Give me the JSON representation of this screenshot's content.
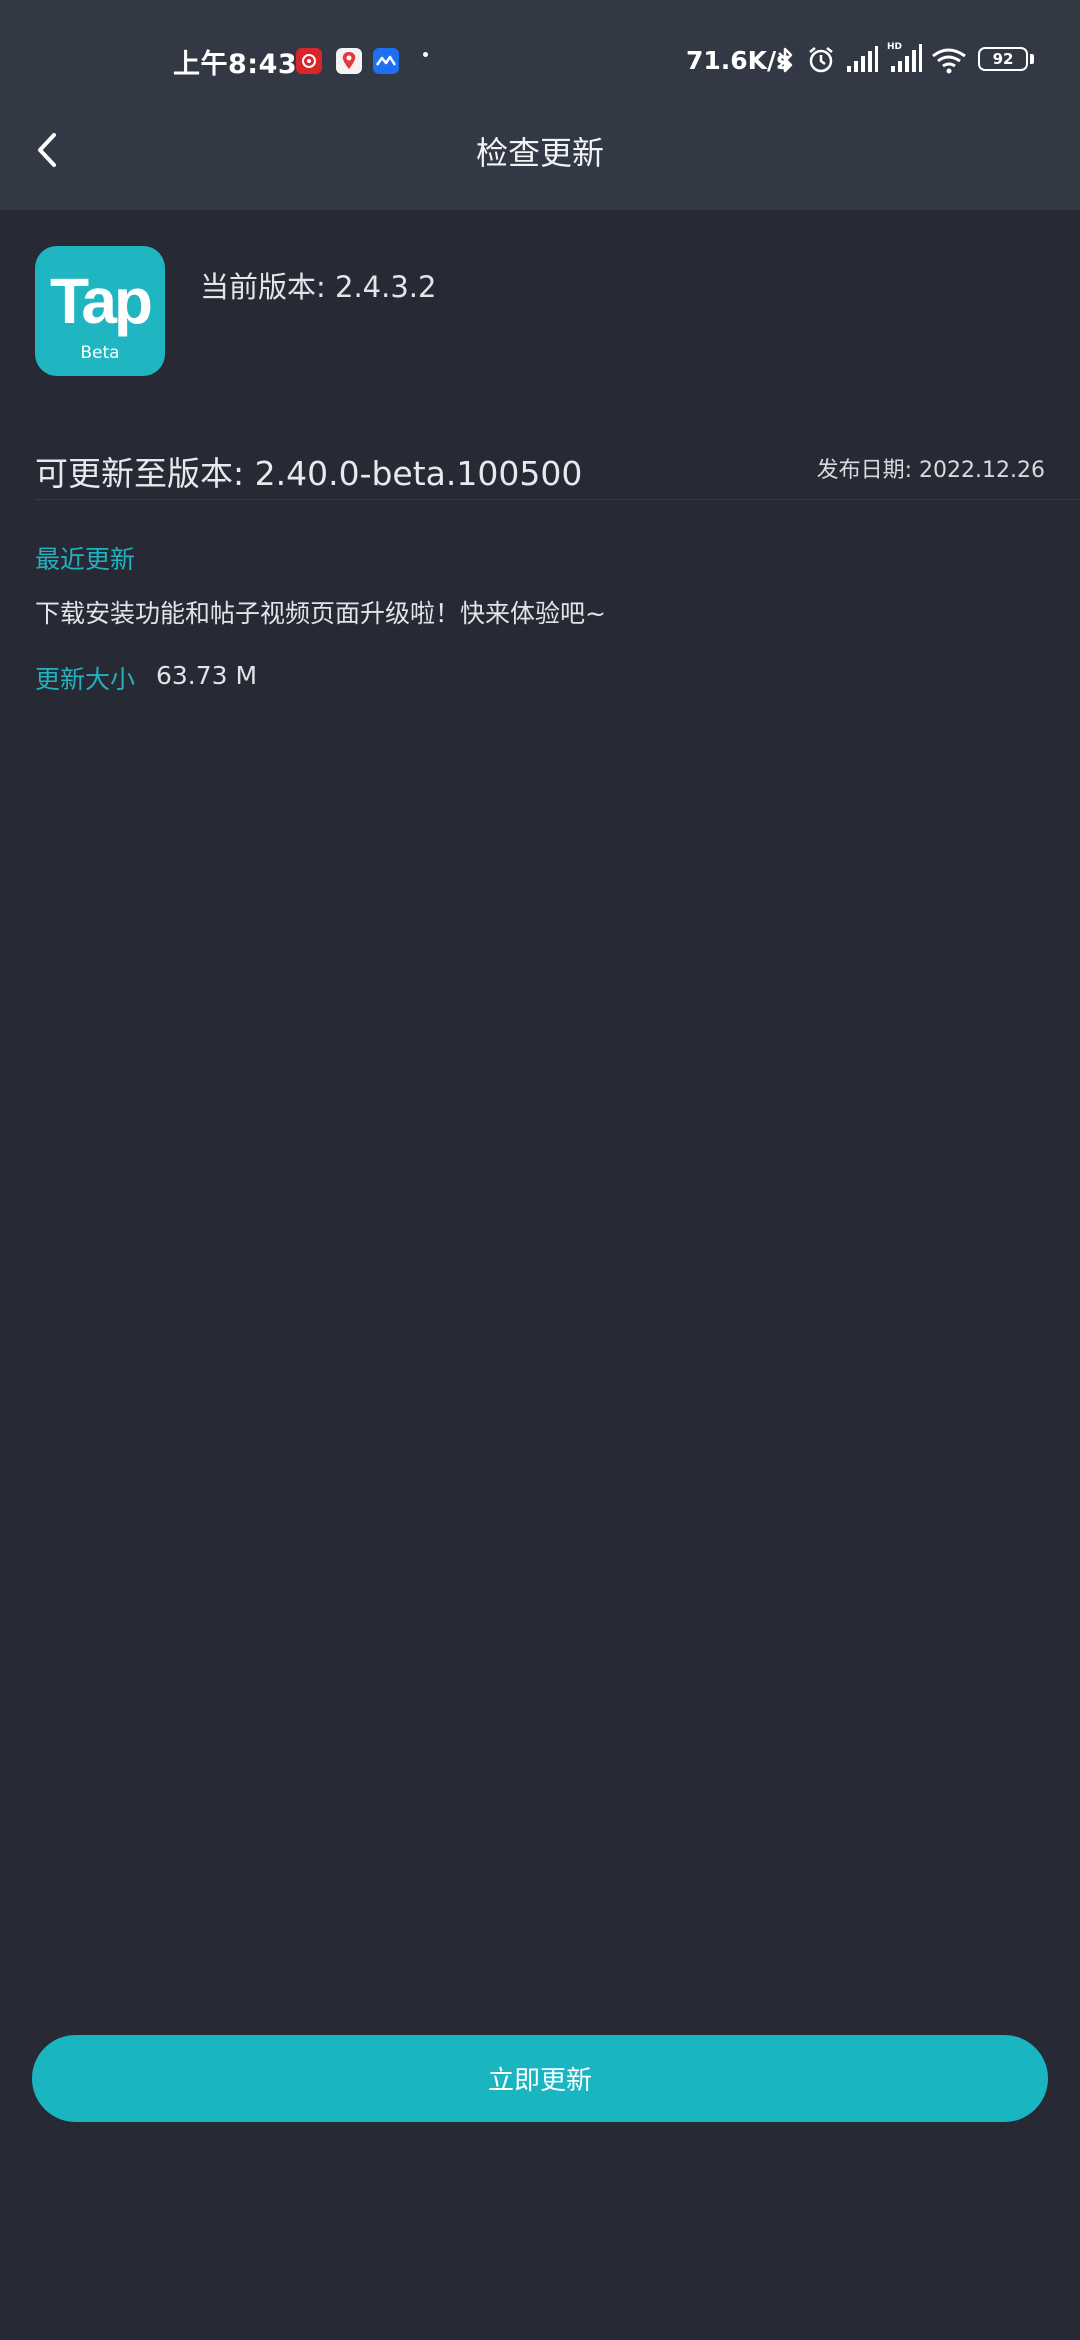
{
  "status_bar": {
    "time": "上午8:43",
    "net_speed": "71.6K/s",
    "battery": "92",
    "notification_icons": [
      "netease-music-icon",
      "maps-icon",
      "feishu-icon"
    ],
    "system_icons": [
      "bluetooth-icon",
      "alarm-icon",
      "signal-icon",
      "signal-hd-icon",
      "wifi-icon"
    ]
  },
  "header": {
    "title": "检查更新",
    "back_icon": "chevron-left-icon"
  },
  "app": {
    "icon_text": "Tap",
    "icon_sub": "Beta",
    "current_version": "当前版本: 2.4.3.2"
  },
  "update": {
    "target_version": "可更新至版本: 2.40.0-beta.100500",
    "release_date": "发布日期: 2022.12.26",
    "recent_label": "最近更新",
    "recent_text": "下载安装功能和帖子视频页面升级啦！快来体验吧~",
    "size_label": "更新大小",
    "size_value": "63.73 M"
  },
  "action": {
    "update_now": "立即更新"
  },
  "colors": {
    "accent": "#1fb6c1",
    "background": "#272a35",
    "header": "#333845"
  }
}
